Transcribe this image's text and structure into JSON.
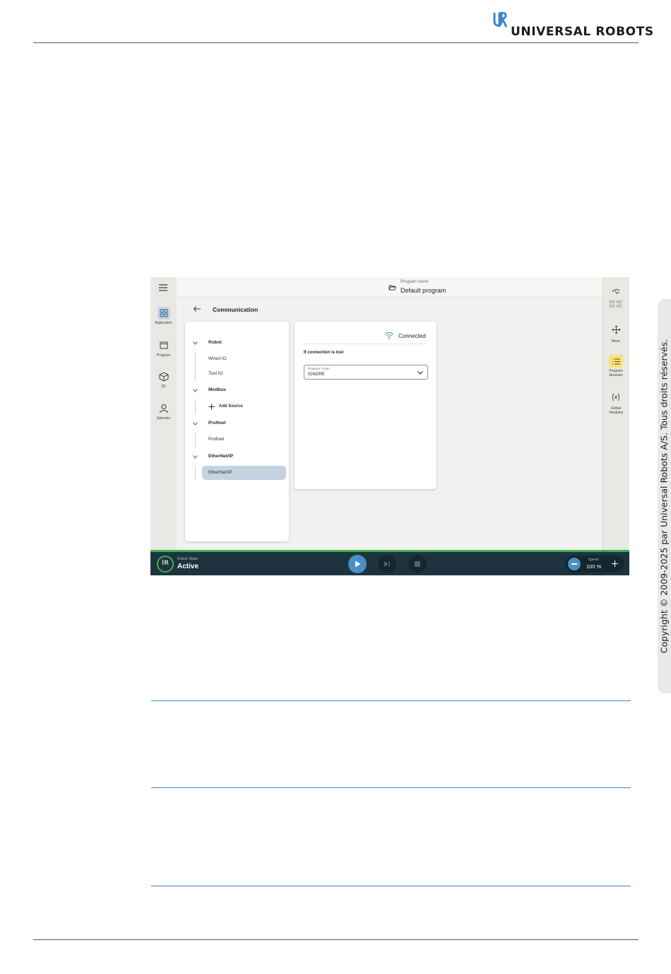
{
  "brand": {
    "logo_text": "UNIVERSAL ROBOTS"
  },
  "copyright": "Copyright © 2009-2025 par Universal Robots A/S. Tous droits réservés.",
  "app": {
    "left_nav": [
      {
        "label": "Application",
        "icon": "application-grid-icon",
        "active": true
      },
      {
        "label": "Program",
        "icon": "program-window-icon",
        "active": false
      },
      {
        "label": "3D",
        "icon": "cube-3d-icon",
        "active": false
      },
      {
        "label": "Operator",
        "icon": "operator-person-icon",
        "active": false
      }
    ],
    "right_nav": [
      {
        "label": "",
        "icon": "freedrive-icon"
      },
      {
        "label": "Move",
        "icon": "move-arrows-icon"
      },
      {
        "label": "Program structure",
        "icon": "program-structure-icon"
      },
      {
        "label": "Global Variables",
        "icon": "global-variables-icon"
      }
    ],
    "program": {
      "caption": "Program name",
      "name": "Default program"
    },
    "page_title": "Communication",
    "tree": {
      "groups": [
        {
          "label": "Robot",
          "items": [
            "Wired IO",
            "Tool IO"
          ]
        },
        {
          "label": "Modbus",
          "items": [
            "Add Source"
          ]
        },
        {
          "label": "Profinet",
          "items": [
            "Profinet"
          ]
        },
        {
          "label": "EtherNet/IP",
          "items": [
            "EtherNet/IP"
          ]
        }
      ],
      "selected": "EtherNet/IP"
    },
    "detail": {
      "status": "Connected",
      "status_color": "#3fae49",
      "section_label": "If connection is lost",
      "select_caption": "Program Action",
      "select_value": "IGNORE"
    },
    "footer": {
      "state_caption": "Robot State",
      "state_value": "Active",
      "speed_caption": "Speed",
      "speed_value": "100 %"
    }
  }
}
